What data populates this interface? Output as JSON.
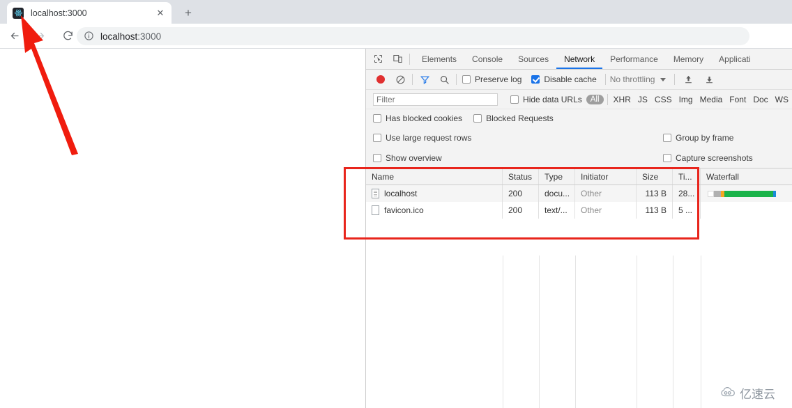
{
  "browser": {
    "tab": {
      "title": "localhost:3000",
      "favicon_name": "react-favicon",
      "close_label": "✕"
    },
    "new_tab_label": "+",
    "nav": {
      "back_label": "←",
      "forward_label": "→",
      "reload_label": "⟳"
    },
    "omnibox": {
      "site_info_icon": "info-icon",
      "host": "localhost",
      "port": ":3000"
    }
  },
  "devtools": {
    "toolbar_icons": {
      "inspect": "inspect-element-icon",
      "device": "device-toolbar-icon"
    },
    "tabs": [
      {
        "label": "Elements",
        "active": false
      },
      {
        "label": "Console",
        "active": false
      },
      {
        "label": "Sources",
        "active": false
      },
      {
        "label": "Network",
        "active": true
      },
      {
        "label": "Performance",
        "active": false
      },
      {
        "label": "Memory",
        "active": false
      },
      {
        "label": "Applicati",
        "active": false
      }
    ],
    "network_toolbar": {
      "record_icon": "record-icon",
      "clear_icon": "clear-icon",
      "filter_icon": "filter-funnel-icon",
      "search_icon": "search-icon",
      "preserve_log": {
        "label": "Preserve log",
        "checked": false
      },
      "disable_cache": {
        "label": "Disable cache",
        "checked": true
      },
      "throttling": {
        "value": "No throttling"
      },
      "import_icon": "import-har-icon",
      "export_icon": "export-har-icon"
    },
    "filter_bar": {
      "filter_placeholder": "Filter",
      "filter_value": "",
      "hide_data_urls": {
        "label": "Hide data URLs",
        "checked": false
      },
      "types": [
        "All",
        "XHR",
        "JS",
        "CSS",
        "Img",
        "Media",
        "Font",
        "Doc",
        "WS"
      ],
      "selected_type": "All",
      "has_blocked_cookies": {
        "label": "Has blocked cookies",
        "checked": false
      },
      "blocked_requests": {
        "label": "Blocked Requests",
        "checked": false
      }
    },
    "settings": {
      "use_large_request_rows": {
        "label": "Use large request rows",
        "checked": false
      },
      "group_by_frame": {
        "label": "Group by frame",
        "checked": false
      },
      "show_overview": {
        "label": "Show overview",
        "checked": false
      },
      "capture_screenshots": {
        "label": "Capture screenshots",
        "checked": false
      }
    },
    "requests_table": {
      "columns": [
        "Name",
        "Status",
        "Type",
        "Initiator",
        "Size",
        "Ti...",
        "Waterfall"
      ],
      "rows": [
        {
          "name": "localhost",
          "icon": "document-icon",
          "status": "200",
          "type": "docu...",
          "initiator": "Other",
          "size": "113 B",
          "time": "28...",
          "waterfall": {
            "segments": [
              "#ffffff",
              "#b0b0b0",
              "#f5a623",
              "#1bb34a",
              "#1a8cd8"
            ]
          }
        },
        {
          "name": "favicon.ico",
          "icon": "document-blank-icon",
          "status": "200",
          "type": "text/...",
          "initiator": "Other",
          "size": "113 B",
          "time": "5 ...",
          "waterfall": {
            "segments": []
          }
        }
      ]
    }
  },
  "annotations": {
    "highlight_box_color": "#e8251c",
    "arrow_color": "#f01c0e",
    "arrow_name": "red-arrow-pointing-to-favicon"
  },
  "watermark": {
    "text": "亿速云",
    "logo_name": "cloud-logo-icon"
  }
}
